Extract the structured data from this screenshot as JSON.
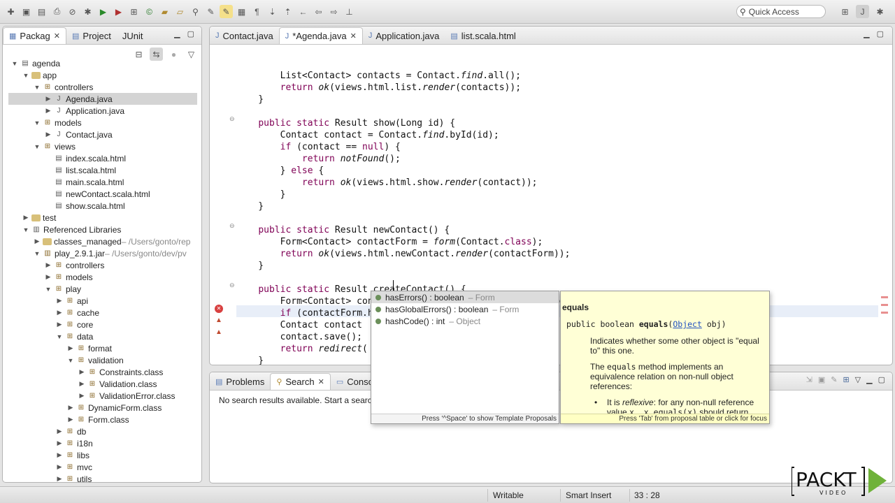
{
  "toolbar": {
    "quick_access": "Quick Access"
  },
  "left_panel": {
    "tabs": [
      {
        "label": "Packag",
        "active": true
      },
      {
        "label": "Project",
        "active": false
      },
      {
        "label": "JUnit",
        "active": false
      }
    ],
    "tree": [
      {
        "depth": 0,
        "arrow": "▼",
        "icon": "project",
        "label": "agenda",
        "extra": ""
      },
      {
        "depth": 1,
        "arrow": "▼",
        "icon": "folder",
        "label": "app",
        "extra": ""
      },
      {
        "depth": 2,
        "arrow": "▼",
        "icon": "package",
        "label": "controllers",
        "extra": ""
      },
      {
        "depth": 3,
        "arrow": "▶",
        "icon": "java",
        "label": "Agenda.java",
        "extra": "",
        "selected": true
      },
      {
        "depth": 3,
        "arrow": "▶",
        "icon": "java",
        "label": "Application.java",
        "extra": ""
      },
      {
        "depth": 2,
        "arrow": "▼",
        "icon": "package",
        "label": "models",
        "extra": ""
      },
      {
        "depth": 3,
        "arrow": "▶",
        "icon": "java",
        "label": "Contact.java",
        "extra": ""
      },
      {
        "depth": 2,
        "arrow": "▼",
        "icon": "package",
        "label": "views",
        "extra": ""
      },
      {
        "depth": 3,
        "arrow": "",
        "icon": "file",
        "label": "index.scala.html",
        "extra": ""
      },
      {
        "depth": 3,
        "arrow": "",
        "icon": "file",
        "label": "list.scala.html",
        "extra": ""
      },
      {
        "depth": 3,
        "arrow": "",
        "icon": "file",
        "label": "main.scala.html",
        "extra": ""
      },
      {
        "depth": 3,
        "arrow": "",
        "icon": "file",
        "label": "newContact.scala.html",
        "extra": ""
      },
      {
        "depth": 3,
        "arrow": "",
        "icon": "file",
        "label": "show.scala.html",
        "extra": ""
      },
      {
        "depth": 1,
        "arrow": "▶",
        "icon": "folder",
        "label": "test",
        "extra": ""
      },
      {
        "depth": 1,
        "arrow": "▼",
        "icon": "library",
        "label": "Referenced Libraries",
        "extra": ""
      },
      {
        "depth": 2,
        "arrow": "▶",
        "icon": "folder",
        "label": "classes_managed",
        "extra": " – /Users/gonto/rep"
      },
      {
        "depth": 2,
        "arrow": "▼",
        "icon": "jar",
        "label": "play_2.9.1.jar",
        "extra": " – /Users/gonto/dev/pv"
      },
      {
        "depth": 3,
        "arrow": "▶",
        "icon": "package",
        "label": "controllers",
        "extra": ""
      },
      {
        "depth": 3,
        "arrow": "▶",
        "icon": "package",
        "label": "models",
        "extra": ""
      },
      {
        "depth": 3,
        "arrow": "▼",
        "icon": "package",
        "label": "play",
        "extra": ""
      },
      {
        "depth": 4,
        "arrow": "▶",
        "icon": "package",
        "label": "api",
        "extra": ""
      },
      {
        "depth": 4,
        "arrow": "▶",
        "icon": "package",
        "label": "cache",
        "extra": ""
      },
      {
        "depth": 4,
        "arrow": "▶",
        "icon": "package",
        "label": "core",
        "extra": ""
      },
      {
        "depth": 4,
        "arrow": "▼",
        "icon": "package",
        "label": "data",
        "extra": ""
      },
      {
        "depth": 5,
        "arrow": "▶",
        "icon": "package",
        "label": "format",
        "extra": ""
      },
      {
        "depth": 5,
        "arrow": "▼",
        "icon": "package",
        "label": "validation",
        "extra": ""
      },
      {
        "depth": 6,
        "arrow": "▶",
        "icon": "class",
        "label": "Constraints.class",
        "extra": ""
      },
      {
        "depth": 6,
        "arrow": "▶",
        "icon": "class",
        "label": "Validation.class",
        "extra": ""
      },
      {
        "depth": 6,
        "arrow": "▶",
        "icon": "class",
        "label": "ValidationError.class",
        "extra": ""
      },
      {
        "depth": 5,
        "arrow": "▶",
        "icon": "class",
        "label": "DynamicForm.class",
        "extra": ""
      },
      {
        "depth": 5,
        "arrow": "▶",
        "icon": "class",
        "label": "Form.class",
        "extra": ""
      },
      {
        "depth": 4,
        "arrow": "▶",
        "icon": "package",
        "label": "db",
        "extra": ""
      },
      {
        "depth": 4,
        "arrow": "▶",
        "icon": "package",
        "label": "i18n",
        "extra": ""
      },
      {
        "depth": 4,
        "arrow": "▶",
        "icon": "package",
        "label": "libs",
        "extra": ""
      },
      {
        "depth": 4,
        "arrow": "▶",
        "icon": "package",
        "label": "mvc",
        "extra": ""
      },
      {
        "depth": 4,
        "arrow": "▶",
        "icon": "package",
        "label": "utils",
        "extra": ""
      }
    ]
  },
  "editor": {
    "tabs": [
      {
        "label": "Contact.java",
        "active": false
      },
      {
        "label": "*Agenda.java",
        "active": true
      },
      {
        "label": "Application.java",
        "active": false
      },
      {
        "label": "list.scala.html",
        "active": false
      }
    ],
    "lines": [
      [
        [
          "        List<Contact> contacts = Contact.",
          ""
        ],
        [
          "find",
          "it"
        ],
        [
          ".all();",
          ""
        ]
      ],
      [
        [
          "        ",
          ""
        ],
        [
          "return",
          "kw"
        ],
        [
          " ",
          ""
        ],
        [
          "ok",
          "it"
        ],
        [
          "(views.html.list.",
          ""
        ],
        [
          "render",
          "it"
        ],
        [
          "(contacts));",
          ""
        ]
      ],
      [
        [
          "    }",
          ""
        ]
      ],
      [
        [
          "",
          ""
        ]
      ],
      [
        [
          "    ",
          ""
        ],
        [
          "public static",
          "kw"
        ],
        [
          " Result show(Long id) {",
          ""
        ]
      ],
      [
        [
          "        Contact contact = Contact.",
          ""
        ],
        [
          "find",
          "it"
        ],
        [
          ".byId(id);",
          ""
        ]
      ],
      [
        [
          "        ",
          ""
        ],
        [
          "if",
          "kw"
        ],
        [
          " (contact == ",
          ""
        ],
        [
          "null",
          "kw"
        ],
        [
          ") {",
          ""
        ]
      ],
      [
        [
          "            ",
          ""
        ],
        [
          "return",
          "kw"
        ],
        [
          " ",
          ""
        ],
        [
          "notFound",
          "it"
        ],
        [
          "();",
          ""
        ]
      ],
      [
        [
          "        } ",
          ""
        ],
        [
          "else",
          "kw"
        ],
        [
          " {",
          ""
        ]
      ],
      [
        [
          "            ",
          ""
        ],
        [
          "return",
          "kw"
        ],
        [
          " ",
          ""
        ],
        [
          "ok",
          "it"
        ],
        [
          "(views.html.show.",
          ""
        ],
        [
          "render",
          "it"
        ],
        [
          "(contact));",
          ""
        ]
      ],
      [
        [
          "        }",
          ""
        ]
      ],
      [
        [
          "    }",
          ""
        ]
      ],
      [
        [
          "",
          ""
        ]
      ],
      [
        [
          "    ",
          ""
        ],
        [
          "public static",
          "kw"
        ],
        [
          " Result newContact() {",
          ""
        ]
      ],
      [
        [
          "        Form<Contact> contactForm = ",
          ""
        ],
        [
          "form",
          "it"
        ],
        [
          "(Contact.",
          ""
        ],
        [
          "class",
          "kw"
        ],
        [
          ");",
          ""
        ]
      ],
      [
        [
          "        ",
          ""
        ],
        [
          "return",
          "kw"
        ],
        [
          " ",
          ""
        ],
        [
          "ok",
          "it"
        ],
        [
          "(views.html.newContact.",
          ""
        ],
        [
          "render",
          "it"
        ],
        [
          "(contactForm));",
          ""
        ]
      ],
      [
        [
          "    }",
          ""
        ]
      ],
      [
        [
          "",
          ""
        ]
      ],
      [
        [
          "    ",
          ""
        ],
        [
          "public static",
          "kw"
        ],
        [
          " Result createContact() {",
          ""
        ]
      ],
      [
        [
          "        Form<Contact> contactForm = ",
          ""
        ],
        [
          "form",
          "it"
        ],
        [
          "(Contact.",
          ""
        ],
        [
          "class",
          "kw"
        ],
        [
          ").bindFromRequest();",
          ""
        ]
      ],
      [
        [
          "        ",
          ""
        ],
        [
          "if",
          "kw"
        ],
        [
          " (contactForm.has",
          ""
        ]
      ],
      [
        [
          "        Contact contact",
          ""
        ]
      ],
      [
        [
          "        contact.save();",
          ""
        ]
      ],
      [
        [
          "        ",
          ""
        ],
        [
          "return",
          "kw"
        ],
        [
          " ",
          ""
        ],
        [
          "redirect",
          "it"
        ],
        [
          "(",
          ""
        ]
      ],
      [
        [
          "    }",
          ""
        ]
      ],
      [
        [
          "",
          ""
        ]
      ],
      [
        [
          "}",
          ""
        ]
      ]
    ]
  },
  "bottom_panel": {
    "tabs": [
      {
        "label": "Problems",
        "active": false
      },
      {
        "label": "Search",
        "active": true
      },
      {
        "label": "Conso",
        "active": false
      }
    ],
    "message": "No search results available. Start a search"
  },
  "content_assist": {
    "proposals": [
      {
        "name": "hasErrors() : boolean",
        "owner": " – Form",
        "selected": true
      },
      {
        "name": "hasGlobalErrors() : boolean",
        "owner": " – Form",
        "selected": false
      },
      {
        "name": "hashCode() : int",
        "owner": " – Object",
        "selected": false
      }
    ],
    "footer": "Press '^Space' to show Template Proposals"
  },
  "javadoc": {
    "title": "equals",
    "sig_prefix": "public boolean ",
    "sig_name": "equals",
    "sig_type": "Object",
    "sig_suffix": " obj)",
    "p1": "Indicates whether some other object is \"equal to\" this one.",
    "p2_pre": "The ",
    "p2_code": "equals",
    "p2_post": " method implements an equivalence relation on non-null object references:",
    "bullet_pre": "It is ",
    "bullet_it": "reflexive",
    "bullet_post": ": for any non-null reference value ",
    "bullet_code": "x, x.equals(x)",
    "bullet_end": " should return true.",
    "footer": "Press 'Tab' from proposal table or click for focus"
  },
  "status_bar": {
    "mode": "Writable",
    "insert": "Smart Insert",
    "position": "33 : 28"
  },
  "logo": {
    "brand": "PACKT",
    "sub": "VIDEO"
  },
  "colors": {
    "keyword": "#7f0055",
    "selection": "#d4d4d4",
    "javadoc_bg": "#ffffd6"
  }
}
